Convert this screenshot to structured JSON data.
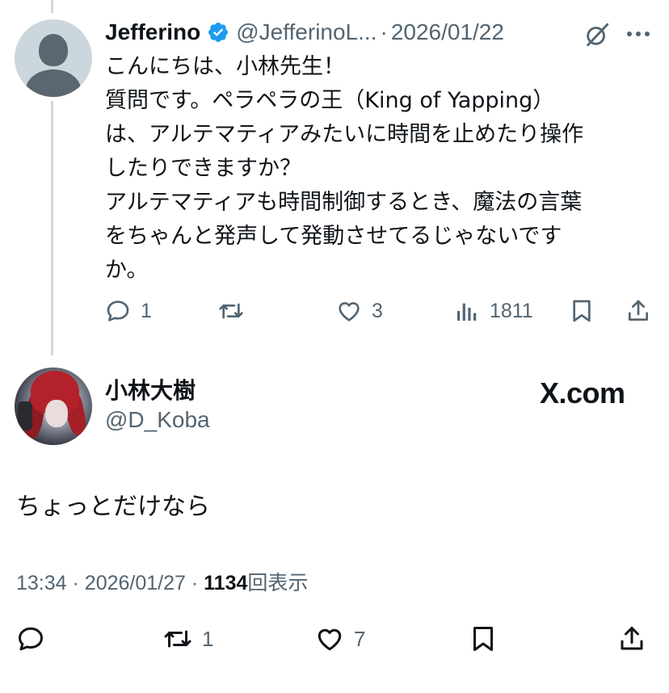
{
  "parent_tweet": {
    "display_name": "Jefferino",
    "handle": "@JefferinoL...",
    "separator": "·",
    "date": "2026/01/22",
    "body_lines": [
      "こんにちは、小林先生！",
      "質問です。ペラペラの王（King of Yapping）",
      "は、アルテマティアみたいに時間を止めたり操作",
      "したりできますか？",
      "アルテマティアも時間制御するとき、魔法の言葉",
      "をちゃんと発声して発動させてるじゃないです",
      "か。"
    ],
    "actions": {
      "replies": "1",
      "retweets": "",
      "likes": "3",
      "views": "1811"
    }
  },
  "main_tweet": {
    "display_name": "小林大樹",
    "handle": "@D_Koba",
    "brand": "X.com",
    "body": "ちょっとだけなら",
    "time": "13:34",
    "separator": "·",
    "date": "2026/01/27",
    "view_count": "1134",
    "view_label": "回表示",
    "actions": {
      "replies": "",
      "retweets": "1",
      "likes": "7"
    }
  },
  "colors": {
    "text_primary": "#0f1419",
    "text_secondary": "#536471",
    "verified_blue": "#1d9bf0",
    "thread_line": "#cfd9de"
  },
  "icons": [
    "verified-badge-icon",
    "grok-icon",
    "more-icon",
    "reply-icon",
    "retweet-icon",
    "like-icon",
    "views-icon",
    "bookmark-icon",
    "share-icon"
  ]
}
